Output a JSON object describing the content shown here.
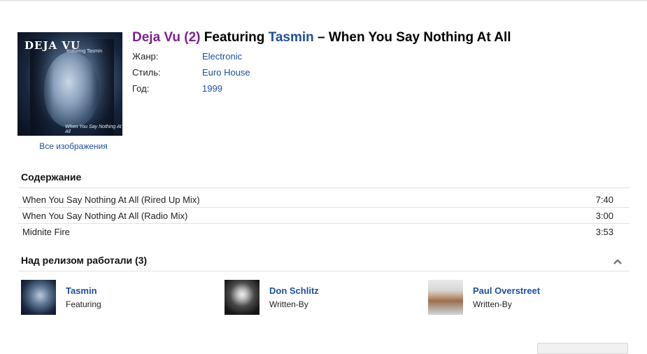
{
  "release": {
    "artist": "Deja Vu (2)",
    "featuring_word": "Featuring",
    "featured_artist": "Tasmin",
    "separator": "–",
    "title": "When You Say Nothing At All"
  },
  "cover": {
    "title_text": "DEJA VU",
    "sub_text": "featuring Tasmin",
    "bottom_text": "When You Say Nothing At All",
    "all_images_link": "Все изображения"
  },
  "meta": [
    {
      "label": "Жанр:",
      "value": "Electronic"
    },
    {
      "label": "Стиль:",
      "value": "Euro House"
    },
    {
      "label": "Год:",
      "value": "1999"
    }
  ],
  "tracklist": {
    "heading": "Содержание",
    "tracks": [
      {
        "title": "When You Say Nothing At All (Rired Up Mix)",
        "duration": "7:40"
      },
      {
        "title": "When You Say Nothing At All (Radio Mix)",
        "duration": "3:00"
      },
      {
        "title": "Midnite Fire",
        "duration": "3:53"
      }
    ]
  },
  "credits": {
    "heading": "Над релизом работали (3)",
    "collapse_icon": "chevron-up-icon",
    "people": [
      {
        "name": "Tasmin",
        "role": "Featuring"
      },
      {
        "name": "Don Schlitz",
        "role": "Written-By"
      },
      {
        "name": "Paul Overstreet",
        "role": "Written-By"
      }
    ]
  },
  "colors": {
    "artist": "#7b2389",
    "link": "#1f4e9a"
  }
}
